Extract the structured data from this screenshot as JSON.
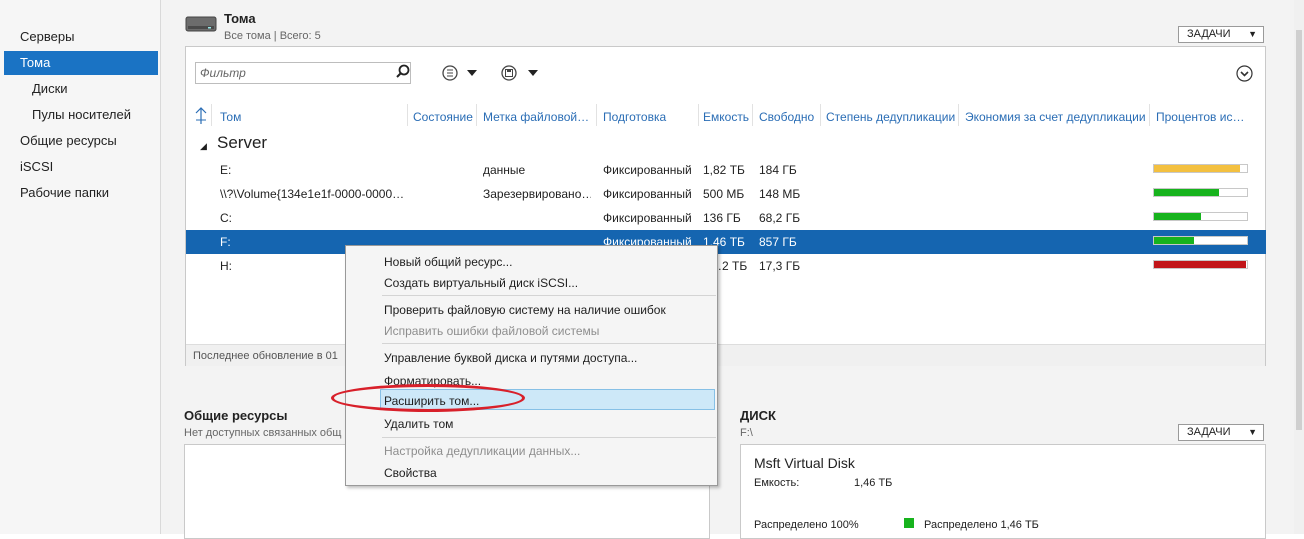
{
  "sidebar": {
    "items": [
      {
        "label": "Серверы"
      },
      {
        "label": "Тома"
      },
      {
        "label": "Диски"
      },
      {
        "label": "Пулы носителей"
      },
      {
        "label": "Общие ресурсы"
      },
      {
        "label": "iSCSI"
      },
      {
        "label": "Рабочие папки"
      }
    ]
  },
  "volumes": {
    "title": "Тома",
    "subtitle": "Все тома | Всего: 5",
    "tasks_label": "ЗАДАЧИ",
    "filter_placeholder": "Фильтр",
    "columns": [
      "Том",
      "Состояние",
      "Метка файловой…",
      "Подготовка",
      "Емкость",
      "Свободно",
      "Степень дедупликации",
      "Экономия за счет дедупликации",
      "Процентов ис…"
    ],
    "group": "Server",
    "rows": [
      {
        "volume": "E:",
        "label": "данные",
        "provisioning": "Фиксированный",
        "capacity": "1,82 ТБ",
        "free": "184 ГБ",
        "used_pct": 92
      },
      {
        "volume": "\\\\?\\Volume{134e1e1f-0000-0000…",
        "label": "Зарезервировано…",
        "provisioning": "Фиксированный",
        "capacity": "500 МБ",
        "free": "148 МБ",
        "used_pct": 70
      },
      {
        "volume": "C:",
        "label": "",
        "provisioning": "Фиксированный",
        "capacity": "136 ГБ",
        "free": "68,2 ГБ",
        "used_pct": 50
      },
      {
        "volume": "F:",
        "label": "",
        "provisioning": "Фиксированный",
        "capacity": "1,46 ТБ",
        "free": "857 ГБ",
        "used_pct": 43
      },
      {
        "volume": "H:",
        "label": "",
        "provisioning": "",
        "capacity": "…2 ТБ",
        "free": "17,3 ГБ",
        "used_pct": 99
      }
    ],
    "status": "Последнее обновление в 01",
    "colors": {
      "yellow": "#f3c040",
      "green": "#17b31d",
      "red": "#c2161a",
      "selection": "#1565b0"
    }
  },
  "context_menu": {
    "items": [
      {
        "label": "Новый общий ресурс...",
        "enabled": true
      },
      {
        "label": "Создать виртуальный диск iSCSI...",
        "enabled": true
      },
      {
        "label": "Проверить файловую систему на наличие ошибок",
        "enabled": true
      },
      {
        "label": "Исправить ошибки файловой системы",
        "enabled": false
      },
      {
        "label": "Управление буквой диска и путями доступа...",
        "enabled": true
      },
      {
        "label": "Форматировать...",
        "enabled": true
      },
      {
        "label": "Расширить том...",
        "enabled": true,
        "highlighted": true
      },
      {
        "label": "Удалить том",
        "enabled": true
      },
      {
        "label": "Настройка дедупликации данных...",
        "enabled": false
      },
      {
        "label": "Свойства",
        "enabled": true
      }
    ]
  },
  "shares": {
    "title": "Общие ресурсы",
    "subtitle": "Нет доступных связанных общ"
  },
  "disk": {
    "title": "ДИСК",
    "subtitle": "F:\\",
    "tasks_label": "ЗАДАЧИ",
    "name": "Msft Virtual Disk",
    "capacity_label": "Емкость:",
    "capacity_value": "1,46 ТБ",
    "allocated_label": "Распределено 100%",
    "allocated_legend": "Распределено 1,46 ТБ"
  }
}
